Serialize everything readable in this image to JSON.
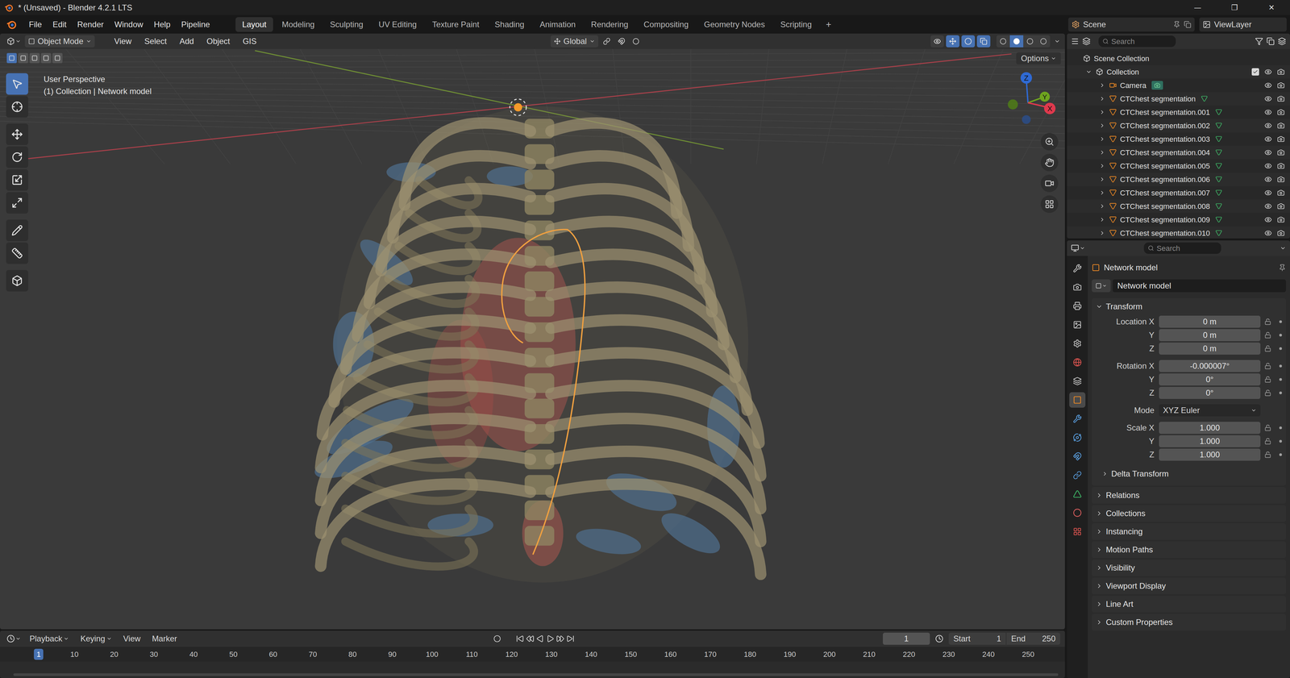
{
  "window": {
    "title": "* (Unsaved) - Blender 4.2.1 LTS",
    "controls": [
      "—",
      "❐",
      "✕"
    ]
  },
  "topbar": {
    "menus": [
      "File",
      "Edit",
      "Render",
      "Window",
      "Help",
      "Pipeline"
    ],
    "workspaces": [
      {
        "label": "Layout",
        "selected": true
      },
      {
        "label": "Modeling",
        "selected": false
      },
      {
        "label": "Sculpting",
        "selected": false
      },
      {
        "label": "UV Editing",
        "selected": false
      },
      {
        "label": "Texture Paint",
        "selected": false
      },
      {
        "label": "Shading",
        "selected": false
      },
      {
        "label": "Animation",
        "selected": false
      },
      {
        "label": "Rendering",
        "selected": false
      },
      {
        "label": "Compositing",
        "selected": false
      },
      {
        "label": "Geometry Nodes",
        "selected": false
      },
      {
        "label": "Scripting",
        "selected": false
      }
    ],
    "add_workspace": "+",
    "scene": "Scene",
    "view_layer": "ViewLayer"
  },
  "viewport": {
    "mode": "Object Mode",
    "menus": [
      "View",
      "Select",
      "Add",
      "Object",
      "GIS"
    ],
    "orientation": "Global",
    "perspective": "User Perspective",
    "context": "(1) Collection | Network model",
    "options": "Options",
    "select_modes": [
      {
        "selected": true
      },
      {
        "selected": false
      },
      {
        "selected": false
      },
      {
        "selected": false
      },
      {
        "selected": false
      }
    ],
    "tools": [
      {
        "kind": "select-box",
        "selected": true,
        "group_start": false
      },
      {
        "kind": "cursor",
        "selected": false,
        "group_start": false
      },
      {
        "kind": "move",
        "selected": false,
        "group_start": true
      },
      {
        "kind": "rotate",
        "selected": false,
        "group_start": false
      },
      {
        "kind": "scale",
        "selected": false,
        "group_start": false
      },
      {
        "kind": "transform",
        "selected": false,
        "group_start": false
      },
      {
        "kind": "annotate",
        "selected": false,
        "group_start": true
      },
      {
        "kind": "measure",
        "selected": false,
        "group_start": false
      },
      {
        "kind": "add-cube",
        "selected": false,
        "group_start": true
      }
    ],
    "toggles": [
      {
        "kind": "visibility",
        "on": false
      },
      {
        "kind": "gizmos",
        "on": true
      },
      {
        "kind": "overlays",
        "on": true
      },
      {
        "kind": "xray",
        "on": true
      }
    ],
    "shading": [
      {
        "kind": "wireframe",
        "selected": false
      },
      {
        "kind": "solid",
        "selected": true
      },
      {
        "kind": "material",
        "selected": false
      },
      {
        "kind": "rendered",
        "selected": false
      }
    ],
    "axes": [
      {
        "label": "Z",
        "color": "#2f6ad4"
      },
      {
        "label": "Y",
        "color": "#6ea31f"
      },
      {
        "label": "X",
        "color": "#e0394d"
      }
    ]
  },
  "outliner": {
    "search": "Search",
    "items": [
      {
        "label": "Scene Collection",
        "depth": 0,
        "kind": "scene-collection"
      },
      {
        "label": "Collection",
        "depth": 1,
        "kind": "collection",
        "expanded": true,
        "checked": true,
        "visible": true,
        "renderable": true
      },
      {
        "label": "Camera",
        "depth": 2,
        "kind": "camera",
        "expanded": false,
        "visible": true,
        "renderable": true
      },
      {
        "label": "CTChest segmentation",
        "depth": 2,
        "kind": "mesh",
        "expanded": false,
        "visible": true,
        "renderable": true
      },
      {
        "label": "CTChest segmentation.001",
        "depth": 2,
        "kind": "mesh",
        "expanded": false,
        "visible": true,
        "renderable": true
      },
      {
        "label": "CTChest segmentation.002",
        "depth": 2,
        "kind": "mesh",
        "expanded": false,
        "visible": true,
        "renderable": true
      },
      {
        "label": "CTChest segmentation.003",
        "depth": 2,
        "kind": "mesh",
        "expanded": false,
        "visible": true,
        "renderable": true
      },
      {
        "label": "CTChest segmentation.004",
        "depth": 2,
        "kind": "mesh",
        "expanded": false,
        "visible": true,
        "renderable": true
      },
      {
        "label": "CTChest segmentation.005",
        "depth": 2,
        "kind": "mesh",
        "expanded": false,
        "visible": true,
        "renderable": true
      },
      {
        "label": "CTChest segmentation.006",
        "depth": 2,
        "kind": "mesh",
        "expanded": false,
        "visible": true,
        "renderable": true
      },
      {
        "label": "CTChest segmentation.007",
        "depth": 2,
        "kind": "mesh",
        "expanded": false,
        "visible": true,
        "renderable": true
      },
      {
        "label": "CTChest segmentation.008",
        "depth": 2,
        "kind": "mesh",
        "expanded": false,
        "visible": true,
        "renderable": true
      },
      {
        "label": "CTChest segmentation.009",
        "depth": 2,
        "kind": "mesh",
        "expanded": false,
        "visible": true,
        "renderable": true
      },
      {
        "label": "CTChest segmentation.010",
        "depth": 2,
        "kind": "mesh",
        "expanded": false,
        "visible": true,
        "renderable": true
      }
    ]
  },
  "properties": {
    "search": "Search",
    "tabs": [
      {
        "kind": "tool",
        "selected": false,
        "color": "#c8c8c8"
      },
      {
        "kind": "render",
        "selected": false,
        "color": "#c8c8c8"
      },
      {
        "kind": "output",
        "selected": false,
        "color": "#c8c8c8"
      },
      {
        "kind": "view-layer",
        "selected": false,
        "color": "#c8c8c8"
      },
      {
        "kind": "scene",
        "selected": false,
        "color": "#c8c8c8"
      },
      {
        "kind": "world",
        "selected": false,
        "color": "#d9534f"
      },
      {
        "kind": "collection",
        "selected": false,
        "color": "#c8c8c8"
      },
      {
        "kind": "object",
        "selected": true,
        "color": "#f08a24"
      },
      {
        "kind": "modifiers",
        "selected": false,
        "color": "#5a9fe0"
      },
      {
        "kind": "particles",
        "selected": false,
        "color": "#5a9fe0"
      },
      {
        "kind": "physics",
        "selected": false,
        "color": "#5a9fe0"
      },
      {
        "kind": "constraints",
        "selected": false,
        "color": "#5a9fe0"
      },
      {
        "kind": "data",
        "selected": false,
        "color": "#3fbf6a"
      },
      {
        "kind": "material",
        "selected": false,
        "color": "#e06060"
      },
      {
        "kind": "texture",
        "selected": false,
        "color": "#d9534f"
      }
    ],
    "object_name": "Network model",
    "datablock": "Network model",
    "transform": {
      "label": "Transform",
      "expanded": true,
      "rows": [
        {
          "kind": "field",
          "label": "Location X",
          "value": "0 m",
          "group_start": false
        },
        {
          "kind": "field",
          "label": "Y",
          "value": "0 m",
          "group_start": false
        },
        {
          "kind": "field",
          "label": "Z",
          "value": "0 m",
          "group_start": false
        },
        {
          "kind": "field",
          "label": "Rotation X",
          "value": "-0.000007°",
          "group_start": true
        },
        {
          "kind": "field",
          "label": "Y",
          "value": "0°",
          "group_start": false
        },
        {
          "kind": "field",
          "label": "Z",
          "value": "0°",
          "group_start": false
        },
        {
          "kind": "dropdown",
          "label": "Mode",
          "value": "XYZ Euler",
          "group_start": true
        },
        {
          "kind": "field",
          "label": "Scale X",
          "value": "1.000",
          "group_start": true
        },
        {
          "kind": "field",
          "label": "Y",
          "value": "1.000",
          "group_start": false
        },
        {
          "kind": "field",
          "label": "Z",
          "value": "1.000",
          "group_start": false
        }
      ],
      "subpanel": {
        "label": "Delta Transform",
        "expanded": false
      }
    },
    "panels": [
      {
        "label": "Relations",
        "expanded": false
      },
      {
        "label": "Collections",
        "expanded": false
      },
      {
        "label": "Instancing",
        "expanded": false
      },
      {
        "label": "Motion Paths",
        "expanded": false
      },
      {
        "label": "Visibility",
        "expanded": false
      },
      {
        "label": "Viewport Display",
        "expanded": false
      },
      {
        "label": "Line Art",
        "expanded": false
      },
      {
        "label": "Custom Properties",
        "expanded": false
      }
    ]
  },
  "timeline": {
    "menus": [
      "Playback",
      "Keying",
      "View",
      "Marker"
    ],
    "current_frame": "1",
    "start_label": "Start",
    "start": "1",
    "end_label": "End",
    "end": "250",
    "ruler": [
      {
        "label": "1",
        "selected": true
      },
      {
        "label": "10",
        "selected": false
      },
      {
        "label": "20",
        "selected": false
      },
      {
        "label": "30",
        "selected": false
      },
      {
        "label": "40",
        "selected": false
      },
      {
        "label": "50",
        "selected": false
      },
      {
        "label": "60",
        "selected": false
      },
      {
        "label": "70",
        "selected": false
      },
      {
        "label": "80",
        "selected": false
      },
      {
        "label": "90",
        "selected": false
      },
      {
        "label": "100",
        "selected": false
      },
      {
        "label": "110",
        "selected": false
      },
      {
        "label": "120",
        "selected": false
      },
      {
        "label": "130",
        "selected": false
      },
      {
        "label": "140",
        "selected": false
      },
      {
        "label": "150",
        "selected": false
      },
      {
        "label": "160",
        "selected": false
      },
      {
        "label": "170",
        "selected": false
      },
      {
        "label": "180",
        "selected": false
      },
      {
        "label": "190",
        "selected": false
      },
      {
        "label": "200",
        "selected": false
      },
      {
        "label": "210",
        "selected": false
      },
      {
        "label": "220",
        "selected": false
      },
      {
        "label": "230",
        "selected": false
      },
      {
        "label": "240",
        "selected": false
      },
      {
        "label": "250",
        "selected": false
      }
    ]
  }
}
